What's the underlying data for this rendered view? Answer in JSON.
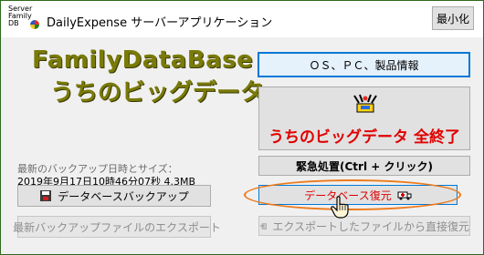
{
  "titlebar": {
    "app_title": "DailyExpense サーバーアプリケーション",
    "icon_text_1": "Server",
    "icon_text_2": "Family",
    "icon_text_3": "DB",
    "minimize_label": "最小化"
  },
  "logo": {
    "line1": "FamilyDataBase",
    "line2": "うちのビッグデータ"
  },
  "backup": {
    "label": "最新のバックアップ日時とサイズ：",
    "value": "2019年9月17日10時46分07秒 4.3MB"
  },
  "buttons": {
    "os_info": "ＯＳ、ＰＣ、製品情報",
    "exit_all": "うちのビッグデータ 全終了",
    "emergency": "緊急処置(Ctrl + クリック)",
    "db_backup": "データベースバックアップ",
    "db_restore": "データベース復元",
    "export_latest": "最新バックアップファイルのエクスポート",
    "restore_from_exported": "エクスポートしたファイルから直接復元"
  },
  "colors": {
    "logo": "#7a7a08",
    "exit_text": "#e00000",
    "highlight_oval": "#ee7a1a",
    "focus_border": "#0078d7"
  }
}
